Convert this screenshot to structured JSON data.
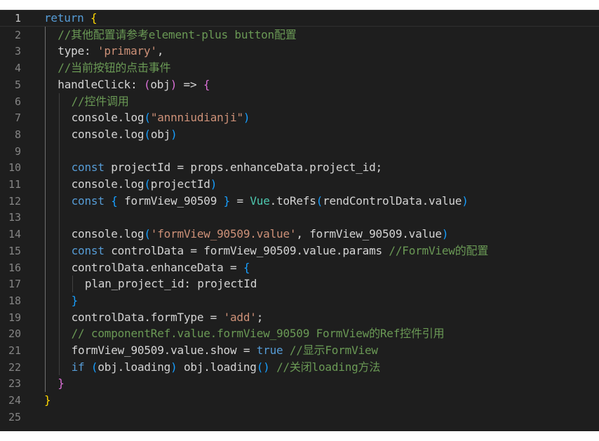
{
  "editor": {
    "line_numbers": [
      "1",
      "2",
      "3",
      "4",
      "5",
      "6",
      "7",
      "8",
      "9",
      "10",
      "11",
      "12",
      "13",
      "14",
      "15",
      "16",
      "17",
      "18",
      "19",
      "20",
      "21",
      "22",
      "23",
      "24",
      "25"
    ],
    "lines": [
      {
        "indent": 0,
        "tokens": [
          [
            "kw",
            "return"
          ],
          [
            "var",
            " "
          ],
          [
            "b1",
            "{"
          ]
        ]
      },
      {
        "indent": 1,
        "tokens": [
          [
            "cm",
            "//其他配置请参考element-plus button配置"
          ]
        ]
      },
      {
        "indent": 1,
        "tokens": [
          [
            "prop",
            "type"
          ],
          [
            "var",
            ": "
          ],
          [
            "str",
            "'primary'"
          ],
          [
            "var",
            ","
          ]
        ]
      },
      {
        "indent": 1,
        "tokens": [
          [
            "cm",
            "//当前按钮的点击事件"
          ]
        ]
      },
      {
        "indent": 1,
        "tokens": [
          [
            "prop",
            "handleClick"
          ],
          [
            "var",
            ": "
          ],
          [
            "b2",
            "("
          ],
          [
            "var",
            "obj"
          ],
          [
            "b2",
            ")"
          ],
          [
            "var",
            " => "
          ],
          [
            "b2",
            "{"
          ]
        ]
      },
      {
        "indent": 2,
        "tokens": [
          [
            "cm",
            "//控件调用"
          ]
        ]
      },
      {
        "indent": 2,
        "tokens": [
          [
            "var",
            "console"
          ],
          [
            "var",
            "."
          ],
          [
            "fn",
            "log"
          ],
          [
            "b3",
            "("
          ],
          [
            "str",
            "\"annniudianji\""
          ],
          [
            "b3",
            ")"
          ]
        ]
      },
      {
        "indent": 2,
        "tokens": [
          [
            "var",
            "console"
          ],
          [
            "var",
            "."
          ],
          [
            "fn",
            "log"
          ],
          [
            "b3",
            "("
          ],
          [
            "var",
            "obj"
          ],
          [
            "b3",
            ")"
          ]
        ]
      },
      {
        "indent": 2,
        "tokens": []
      },
      {
        "indent": 2,
        "tokens": [
          [
            "kw",
            "const"
          ],
          [
            "var",
            " projectId = props.enhanceData.project_id;"
          ]
        ]
      },
      {
        "indent": 2,
        "tokens": [
          [
            "var",
            "console.log"
          ],
          [
            "b3",
            "("
          ],
          [
            "var",
            "projectId"
          ],
          [
            "b3",
            ")"
          ]
        ]
      },
      {
        "indent": 2,
        "tokens": [
          [
            "kw",
            "const"
          ],
          [
            "var",
            " "
          ],
          [
            "b3",
            "{"
          ],
          [
            "var",
            " formView_90509 "
          ],
          [
            "b3",
            "}"
          ],
          [
            "var",
            " = "
          ],
          [
            "cls",
            "Vue"
          ],
          [
            "var",
            ".toRefs"
          ],
          [
            "b3",
            "("
          ],
          [
            "var",
            "rendControlData.value"
          ],
          [
            "b3",
            ")"
          ]
        ]
      },
      {
        "indent": 2,
        "tokens": []
      },
      {
        "indent": 2,
        "tokens": [
          [
            "var",
            "console.log"
          ],
          [
            "b3",
            "("
          ],
          [
            "str",
            "'formView_90509.value'"
          ],
          [
            "var",
            ", formView_90509.value"
          ],
          [
            "b3",
            ")"
          ]
        ]
      },
      {
        "indent": 2,
        "tokens": [
          [
            "kw",
            "const"
          ],
          [
            "var",
            " controlData = formView_90509.value.params "
          ],
          [
            "cm",
            "//FormView的配置"
          ]
        ]
      },
      {
        "indent": 2,
        "tokens": [
          [
            "var",
            "controlData.enhanceData = "
          ],
          [
            "b3",
            "{"
          ]
        ]
      },
      {
        "indent": 3,
        "tokens": [
          [
            "var",
            "plan_project_id: projectId"
          ]
        ]
      },
      {
        "indent": 2,
        "tokens": [
          [
            "b3",
            "}"
          ]
        ]
      },
      {
        "indent": 2,
        "tokens": [
          [
            "var",
            "controlData.formType = "
          ],
          [
            "str",
            "'add'"
          ],
          [
            "var",
            ";"
          ]
        ]
      },
      {
        "indent": 2,
        "tokens": [
          [
            "cm",
            "// componentRef.value.formView_90509 FormView的Ref控件引用"
          ]
        ]
      },
      {
        "indent": 2,
        "tokens": [
          [
            "var",
            "formView_90509.value.show = "
          ],
          [
            "kw",
            "true"
          ],
          [
            "var",
            " "
          ],
          [
            "cm",
            "//显示FormView"
          ]
        ]
      },
      {
        "indent": 2,
        "tokens": [
          [
            "kw",
            "if"
          ],
          [
            "var",
            " "
          ],
          [
            "b3",
            "("
          ],
          [
            "var",
            "obj.loading"
          ],
          [
            "b3",
            ")"
          ],
          [
            "var",
            " obj.loading"
          ],
          [
            "b3",
            "()"
          ],
          [
            "var",
            " "
          ],
          [
            "cm",
            "//关闭loading方法"
          ]
        ]
      },
      {
        "indent": 1,
        "tokens": [
          [
            "b2",
            "}"
          ]
        ]
      },
      {
        "indent": 0,
        "tokens": [
          [
            "b1",
            "}"
          ]
        ]
      },
      {
        "indent": 0,
        "tokens": []
      }
    ],
    "current_line": 1
  }
}
